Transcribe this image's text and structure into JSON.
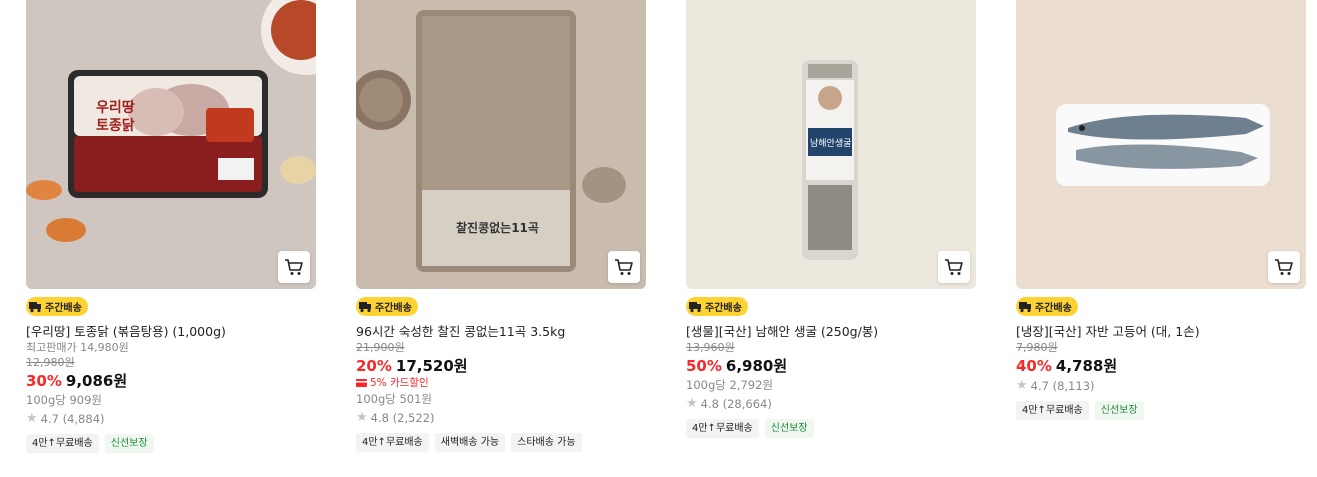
{
  "products": [
    {
      "badge": "주간배송",
      "title": "[우리땅] 토종닭 (볶음탕용) (1,000g)",
      "best_price_label": "최고판매가 14,980원",
      "original_price": "12,980원",
      "discount": "30%",
      "price": "9,086원",
      "unit_price": "100g당 909원",
      "rating": "4.7 (4,884)",
      "tags": [
        "4만↑무료배송",
        "신선보장"
      ]
    },
    {
      "badge": "주간배송",
      "title": "96시간 숙성한 찰진 콩없는11곡 3.5kg",
      "original_price": "21,900원",
      "discount": "20%",
      "price": "17,520원",
      "card_discount": "5% 카드할인",
      "unit_price": "100g당 501원",
      "rating": "4.8 (2,522)",
      "tags": [
        "4만↑무료배송",
        "새벽배송 가능",
        "스타배송 가능"
      ]
    },
    {
      "badge": "주간배송",
      "title": "[생물][국산] 남해안 생굴 (250g/봉)",
      "original_price": "13,960원",
      "discount": "50%",
      "price": "6,980원",
      "unit_price": "100g당 2,792원",
      "rating": "4.8 (28,664)",
      "tags": [
        "4만↑무료배송",
        "신선보장"
      ]
    },
    {
      "badge": "주간배송",
      "title": "[냉장][국산] 자반 고등어 (대, 1손)",
      "original_price": "7,980원",
      "discount": "40%",
      "price": "4,788원",
      "rating": "4.7 (8,113)",
      "tags": [
        "4만↑무료배송",
        "신선보장"
      ]
    }
  ],
  "colors": {
    "badge_yellow": "#ffd233",
    "discount_red": "#fa2828",
    "fresh_green": "#1e8a3a"
  }
}
